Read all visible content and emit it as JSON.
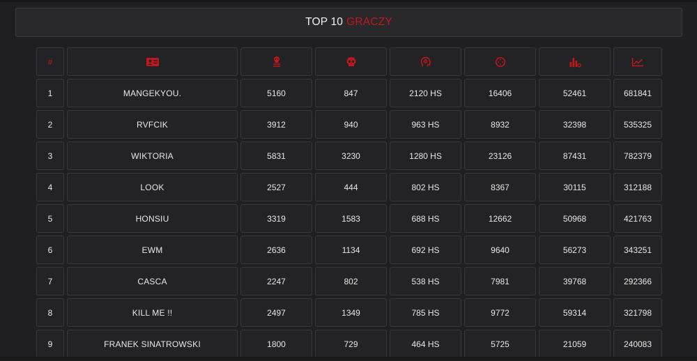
{
  "title": {
    "part1": "TOP 10",
    "part2": "GRACZY"
  },
  "colors": {
    "accent": "#c4161c",
    "background": "#1f1f21",
    "cell": "#232325",
    "border": "#38383b"
  },
  "headers": [
    {
      "key": "rank",
      "label": "#"
    },
    {
      "key": "name",
      "icon": "id-card-icon"
    },
    {
      "key": "kills",
      "icon": "skull-crossbones-icon"
    },
    {
      "key": "deaths",
      "icon": "skull-icon"
    },
    {
      "key": "headshots",
      "icon": "head-target-icon"
    },
    {
      "key": "shots",
      "icon": "crosshair-icon"
    },
    {
      "key": "hits",
      "icon": "chart-bars-coins-icon"
    },
    {
      "key": "damage",
      "icon": "line-chart-icon"
    }
  ],
  "rows": [
    {
      "rank": "1",
      "name": "MANGEKYOU.",
      "kills": "5160",
      "deaths": "847",
      "hs": "2120 HS",
      "shots": "16406",
      "hits": "52461",
      "damage": "681841"
    },
    {
      "rank": "2",
      "name": "RVFCIK",
      "kills": "3912",
      "deaths": "940",
      "hs": "963 HS",
      "shots": "8932",
      "hits": "32398",
      "damage": "535325"
    },
    {
      "rank": "3",
      "name": "WIKTORIA",
      "kills": "5831",
      "deaths": "3230",
      "hs": "1280 HS",
      "shots": "23126",
      "hits": "87431",
      "damage": "782379"
    },
    {
      "rank": "4",
      "name": "LOOK",
      "kills": "2527",
      "deaths": "444",
      "hs": "802 HS",
      "shots": "8367",
      "hits": "30115",
      "damage": "312188"
    },
    {
      "rank": "5",
      "name": "HONSIU",
      "kills": "3319",
      "deaths": "1583",
      "hs": "688 HS",
      "shots": "12662",
      "hits": "50968",
      "damage": "421763"
    },
    {
      "rank": "6",
      "name": "EWM",
      "kills": "2636",
      "deaths": "1134",
      "hs": "692 HS",
      "shots": "9640",
      "hits": "56273",
      "damage": "343251"
    },
    {
      "rank": "7",
      "name": "CASCA",
      "kills": "2247",
      "deaths": "802",
      "hs": "538 HS",
      "shots": "7981",
      "hits": "39768",
      "damage": "292366"
    },
    {
      "rank": "8",
      "name": "KILL ME !!",
      "kills": "2497",
      "deaths": "1349",
      "hs": "785 HS",
      "shots": "9772",
      "hits": "59314",
      "damage": "321798"
    },
    {
      "rank": "9",
      "name": "FRANEK SINATROWSKI",
      "kills": "1800",
      "deaths": "729",
      "hs": "464 HS",
      "shots": "5725",
      "hits": "21059",
      "damage": "240083"
    }
  ]
}
